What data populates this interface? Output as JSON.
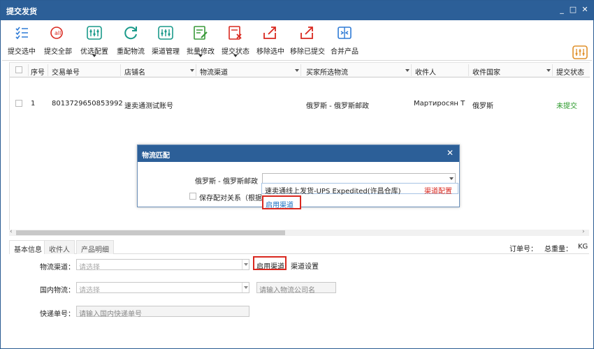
{
  "window": {
    "title": "提交发货",
    "controls": [
      "_",
      "□",
      "✕"
    ]
  },
  "toolbar": {
    "buttons": [
      {
        "label": "提交选中",
        "icon": "list-check-icon",
        "color": "#2e7bd6"
      },
      {
        "label": "提交全部",
        "icon": "submit-all-icon",
        "color": "#d9281f"
      },
      {
        "label": "优选配置",
        "icon": "config-icon",
        "color": "#1a9a8a"
      },
      {
        "label": "重配物流",
        "icon": "refresh-icon",
        "color": "#1a9a8a"
      },
      {
        "label": "渠道管理",
        "icon": "channel-icon",
        "color": "#1a9a8a"
      },
      {
        "label": "批量修改",
        "icon": "edit-icon",
        "color": "#3a9a3a"
      },
      {
        "label": "提交状态",
        "icon": "status-icon",
        "color": "#d9281f"
      },
      {
        "label": "移除选中",
        "icon": "remove-selected-icon",
        "color": "#d9281f"
      },
      {
        "label": "移除已提交",
        "icon": "remove-submitted-icon",
        "color": "#d9281f"
      },
      {
        "label": "合并产品",
        "icon": "merge-icon",
        "color": "#2e7bd6"
      }
    ]
  },
  "table": {
    "headers": [
      "序号",
      "交易单号",
      "店铺名",
      "物流渠道",
      "买家所选物流",
      "收件人",
      "收件国家",
      "提交状态"
    ],
    "rows": [
      {
        "index": "1",
        "trade_no": "8013729650853992",
        "shop": "速卖通测试账号",
        "channel": "",
        "buyer_logistics": "俄罗斯 - 俄罗斯邮政",
        "receiver": "Мартиросян Т",
        "country": "俄罗斯",
        "status": "未提交"
      }
    ]
  },
  "tabs": [
    "基本信息",
    "收件人",
    "产品明细"
  ],
  "order_info": {
    "order_no_label": "订单号：",
    "total_weight_label": "总重量：",
    "weight_unit": "KG"
  },
  "form": {
    "channel_label": "物流渠道：",
    "channel_placeholder": "请选择",
    "enable_channel": "启用渠道",
    "channel_settings": "渠道设置",
    "domestic_label": "国内物流：",
    "domestic_placeholder": "请选择",
    "company_placeholder": "请输入物流公司名",
    "express_label": "快递单号：",
    "express_placeholder": "请输入国内快递单号"
  },
  "dialog": {
    "title": "物流匹配",
    "close": "✕",
    "mapping_label": "俄罗斯 - 俄罗斯邮政",
    "save_label": "保存配对关系（根据",
    "dropdown_option": "速卖通线上发货-UPS Expedited(许昌仓库)",
    "dropdown_config": "渠道配置",
    "enable_channel": "启用渠道"
  }
}
